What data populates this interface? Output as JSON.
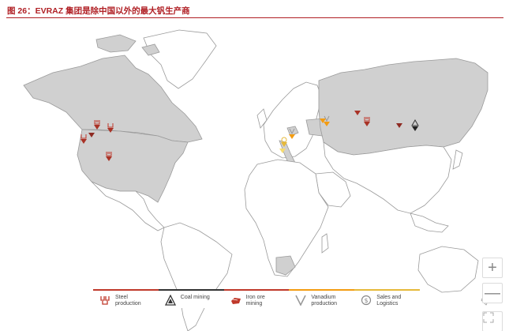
{
  "figure": {
    "title": "图 26：EVRAZ 集团是除中国以外的最大钒生产商"
  },
  "map_controls": {
    "zoom_in_label": "+",
    "zoom_out_label": "—",
    "fullscreen_label": "⤢"
  },
  "legend": {
    "items": [
      {
        "label": "Steel production",
        "icon": "steel-production-icon",
        "color": "#c0392b"
      },
      {
        "label": "Coal mining",
        "icon": "coal-mining-icon",
        "color": "#333333"
      },
      {
        "label": "Iron ore mining",
        "icon": "iron-ore-mining-icon",
        "color": "#c0392b"
      },
      {
        "label": "Vanadium production",
        "icon": "vanadium-production-icon",
        "color": "#f39c12"
      },
      {
        "label": "Sales and Logistics",
        "icon": "sales-logistics-icon",
        "color": "#e6b93a"
      }
    ]
  },
  "colors": {
    "highlight_country": "#d0d0d0",
    "other_land": "#ffffff",
    "border": "#9a9a9a",
    "title_red": "#b01f24"
  }
}
